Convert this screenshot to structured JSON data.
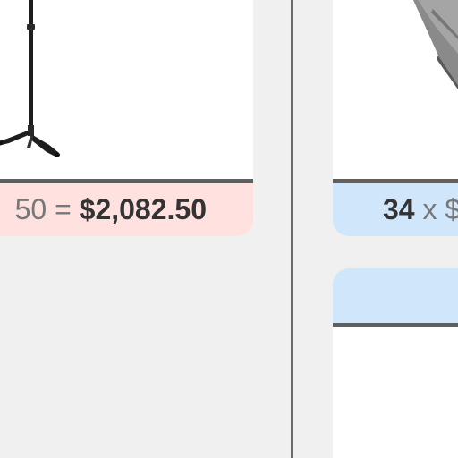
{
  "left_card": {
    "image": "microphone-stand",
    "total": {
      "unit_price_tail": "50",
      "equals": "=",
      "amount": "$2,082.50"
    }
  },
  "right_card": {
    "image": "portable-stage-platform",
    "total": {
      "quantity": "34",
      "times": "x",
      "price_head": "$"
    }
  },
  "colors": {
    "left_total_bg": "#ffe1e0",
    "right_total_bg": "#cfe6fb",
    "divider": "#6a6a6a"
  }
}
